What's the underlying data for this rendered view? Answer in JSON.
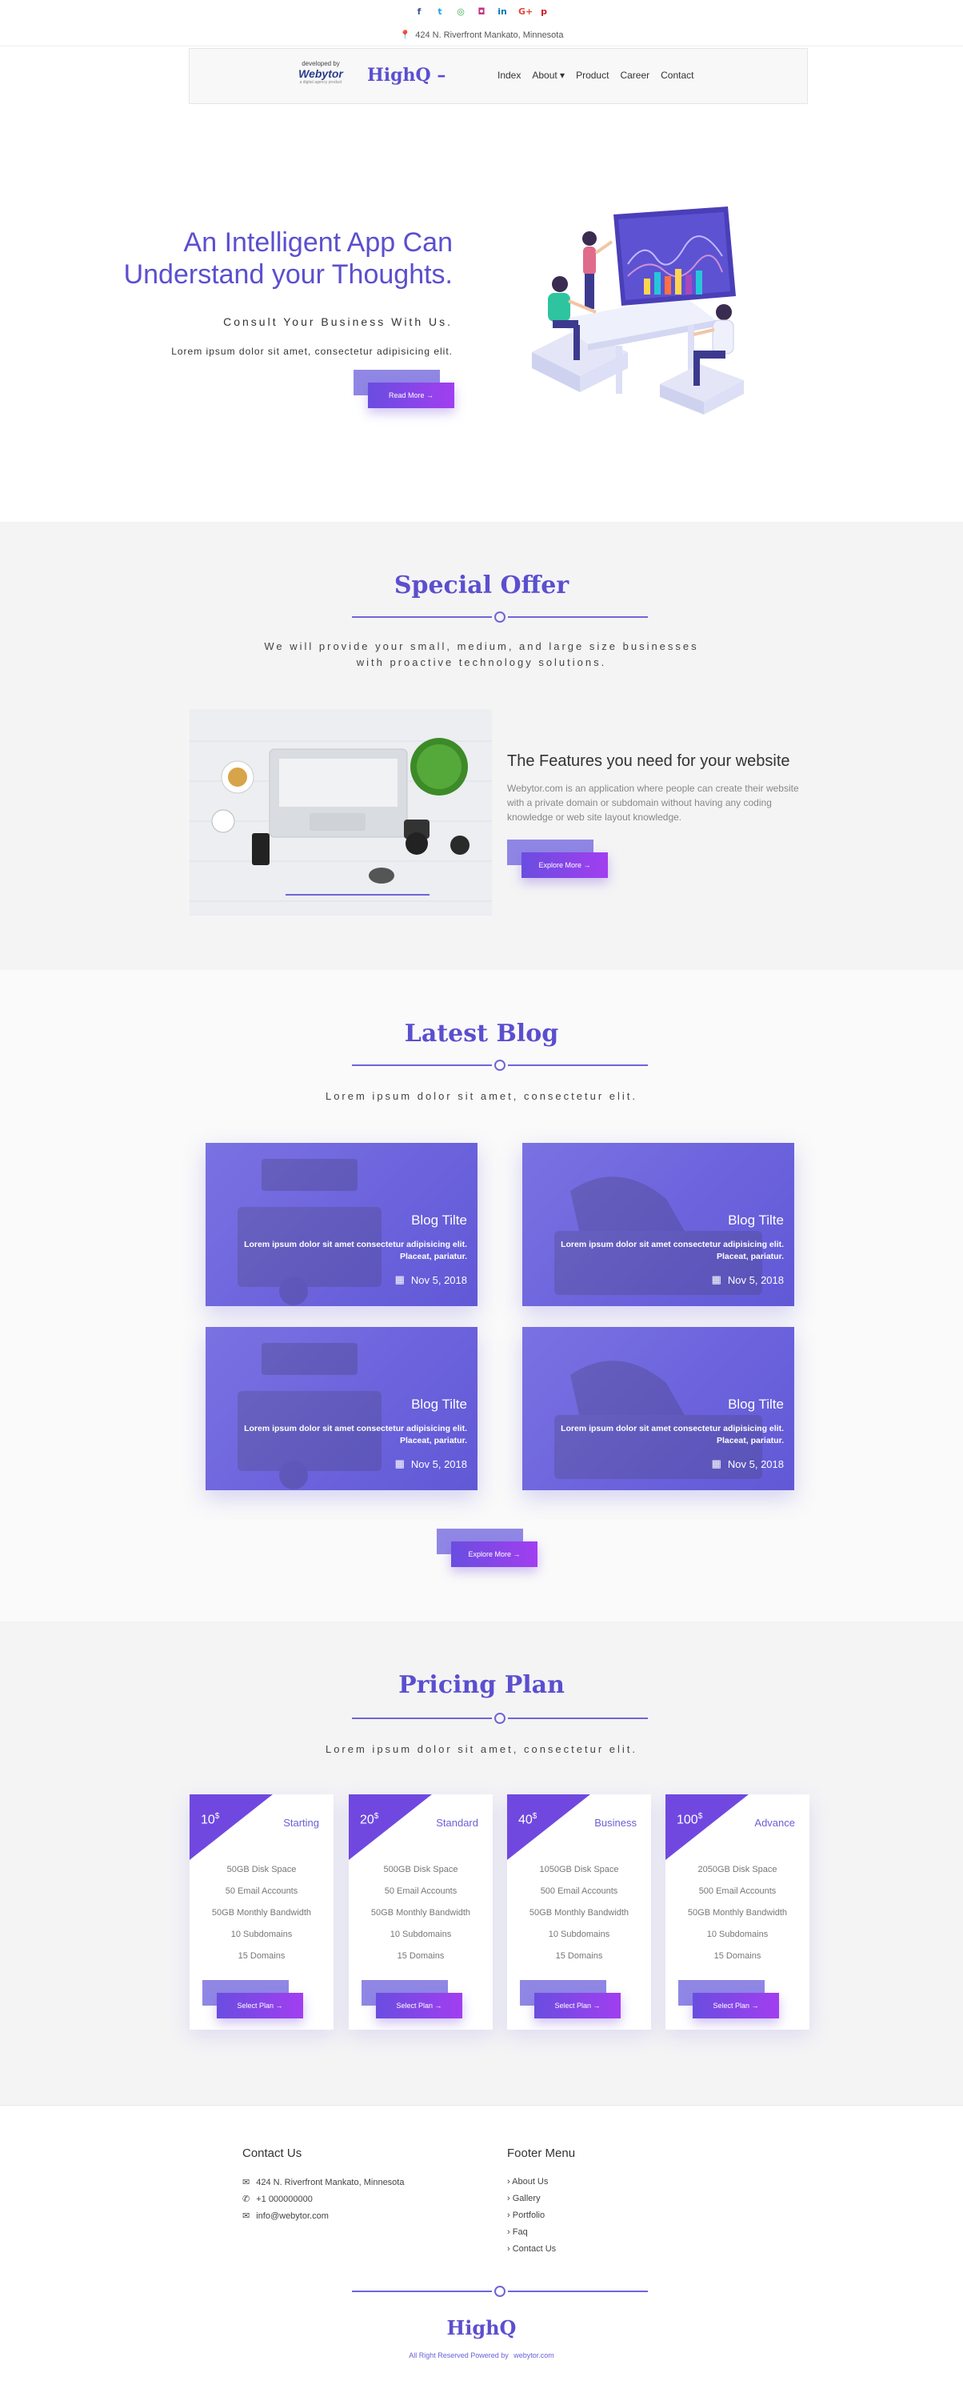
{
  "social": [
    {
      "name": "facebook-icon",
      "glyph": "f",
      "color": "#3b5998"
    },
    {
      "name": "twitter-icon",
      "glyph": "t",
      "color": "#1da1f2"
    },
    {
      "name": "github-icon",
      "glyph": "◎",
      "color": "#3aa84a"
    },
    {
      "name": "instagram-icon",
      "glyph": "◘",
      "color": "#c13584"
    },
    {
      "name": "linkedin-icon",
      "glyph": "in",
      "color": "#0077b5"
    },
    {
      "name": "googleplus-icon",
      "glyph": "G+",
      "color": "#dd4b39"
    },
    {
      "name": "pinterest-icon",
      "glyph": "p",
      "color": "#cb2027"
    }
  ],
  "address_bar": "424 N. Riverfront Mankato, Minnesota",
  "nav": {
    "logo_top": "developed by",
    "logo_main": "Webytor",
    "logo_sub": "a digital agency product",
    "brand": "HighQ –",
    "links": [
      "Index",
      "About ▾",
      "Product",
      "Career",
      "Contact"
    ]
  },
  "hero": {
    "title": "An Intelligent App Can Understand your Thoughts.",
    "subtitle": "Consult Your Business With Us.",
    "text": "Lorem ipsum dolor sit amet, consectetur adipisicing elit.",
    "button": "Read More →"
  },
  "offer": {
    "heading": "Special Offer",
    "subheading": "We will provide your small, medium, and large size businesses with proactive technology solutions.",
    "feature_title": "The Features you need for your website",
    "feature_text": "Webytor.com is an application where people can create their website with a private domain or subdomain without having any coding knowledge or web site layout knowledge.",
    "button": "Explore More →"
  },
  "blog": {
    "heading": "Latest Blog",
    "subheading": "Lorem ipsum dolor sit amet, consectetur elit.",
    "cards": [
      {
        "title": "Blog Tilte",
        "text": "Lorem ipsum dolor sit amet consectetur adipisicing elit. Placeat, pariatur.",
        "date": "Nov 5, 2018"
      },
      {
        "title": "Blog Tilte",
        "text": "Lorem ipsum dolor sit amet consectetur adipisicing elit. Placeat, pariatur.",
        "date": "Nov 5, 2018"
      },
      {
        "title": "Blog Tilte",
        "text": "Lorem ipsum dolor sit amet consectetur adipisicing elit. Placeat, pariatur.",
        "date": "Nov 5, 2018"
      },
      {
        "title": "Blog Tilte",
        "text": "Lorem ipsum dolor sit amet consectetur adipisicing elit. Placeat, pariatur.",
        "date": "Nov 5, 2018"
      }
    ],
    "button": "Explore More →"
  },
  "pricing": {
    "heading": "Pricing Plan",
    "subheading": "Lorem ipsum dolor sit amet, consectetur elit.",
    "plans": [
      {
        "price": "10",
        "currency": "$",
        "name": "Starting",
        "features": [
          "50GB Disk Space",
          "50 Email Accounts",
          "50GB Monthly Bandwidth",
          "10 Subdomains",
          "15 Domains"
        ],
        "button": "Select Plan →"
      },
      {
        "price": "20",
        "currency": "$",
        "name": "Standard",
        "features": [
          "500GB Disk Space",
          "50 Email Accounts",
          "50GB Monthly Bandwidth",
          "10 Subdomains",
          "15 Domains"
        ],
        "button": "Select Plan →"
      },
      {
        "price": "40",
        "currency": "$",
        "name": "Business",
        "features": [
          "1050GB Disk Space",
          "500 Email Accounts",
          "50GB Monthly Bandwidth",
          "10 Subdomains",
          "15 Domains"
        ],
        "button": "Select Plan →"
      },
      {
        "price": "100",
        "currency": "$",
        "name": "Advance",
        "features": [
          "2050GB Disk Space",
          "500 Email Accounts",
          "50GB Monthly Bandwidth",
          "10 Subdomains",
          "15 Domains"
        ],
        "button": "Select Plan →"
      }
    ]
  },
  "footer": {
    "contact_heading": "Contact Us",
    "address": "424 N. Riverfront Mankato, Minnesota",
    "phone": "+1 000000000",
    "email": "info@webytor.com",
    "menu_heading": "Footer Menu",
    "menu": [
      "About Us",
      "Gallery",
      "Portfolio",
      "Faq",
      "Contact Us"
    ],
    "brand": "HighQ",
    "copyright": "All Right Reserved Powered by",
    "copyright_link": "webytor.com"
  },
  "colors": {
    "accent": "#5b4fcf",
    "gradient_start": "#6a4de0",
    "gradient_end": "#a23ef0"
  }
}
